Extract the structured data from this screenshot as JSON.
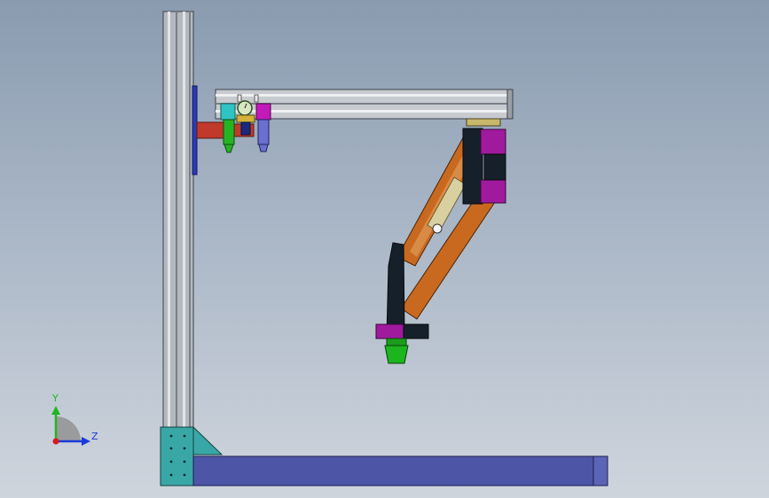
{
  "viewport": {
    "background_top": "#8a9bb0",
    "background_bottom": "#cfd5dd"
  },
  "triad": {
    "y_label": "Y",
    "z_label": "Z",
    "y_color": "#22b422",
    "z_color": "#1a3ad8",
    "x_color": "#d81a1a"
  },
  "colors": {
    "column": "#b4b9bf",
    "beam": "#c7cbcf",
    "base_beam": "#4d55a6",
    "gusset": "#3aa7a7",
    "link_arm": "#c8691f",
    "carriage": "#a01a9e",
    "dark_plate": "#16202a",
    "nozzle": "#1db51d",
    "bracket": "#c0392b"
  }
}
